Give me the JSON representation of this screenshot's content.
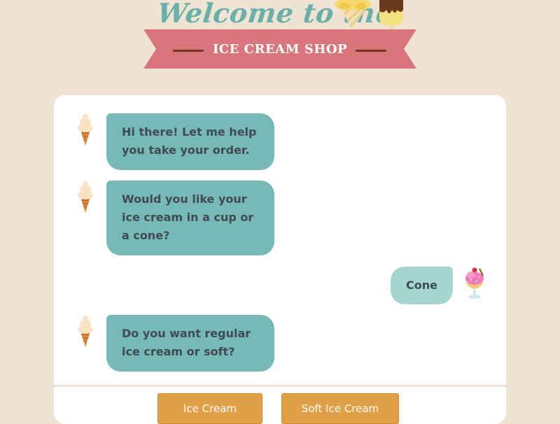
{
  "header": {
    "welcome": "Welcome to the",
    "shop_name": "ICE CREAM SHOP"
  },
  "messages": [
    {
      "from": "bot",
      "text": "Hi there! Let me help you take your order."
    },
    {
      "from": "bot",
      "text": "Would you like your ice cream in a cup or a cone?"
    },
    {
      "from": "user",
      "text": "Cone"
    },
    {
      "from": "bot",
      "text": "Do you want regular ice cream or soft?"
    }
  ],
  "options": [
    "Ice Cream",
    "Soft Ice Cream"
  ],
  "colors": {
    "background": "#efe3d3",
    "bot_bubble": "#77b9b7",
    "user_bubble": "#a5d6d2",
    "ribbon": "#d9767b",
    "button": "#e2a046",
    "title_teal": "#6ab0aa"
  },
  "icons": {
    "bot_avatar": "ice-cream-cone-icon",
    "user_avatar": "sundae-cup-icon"
  }
}
